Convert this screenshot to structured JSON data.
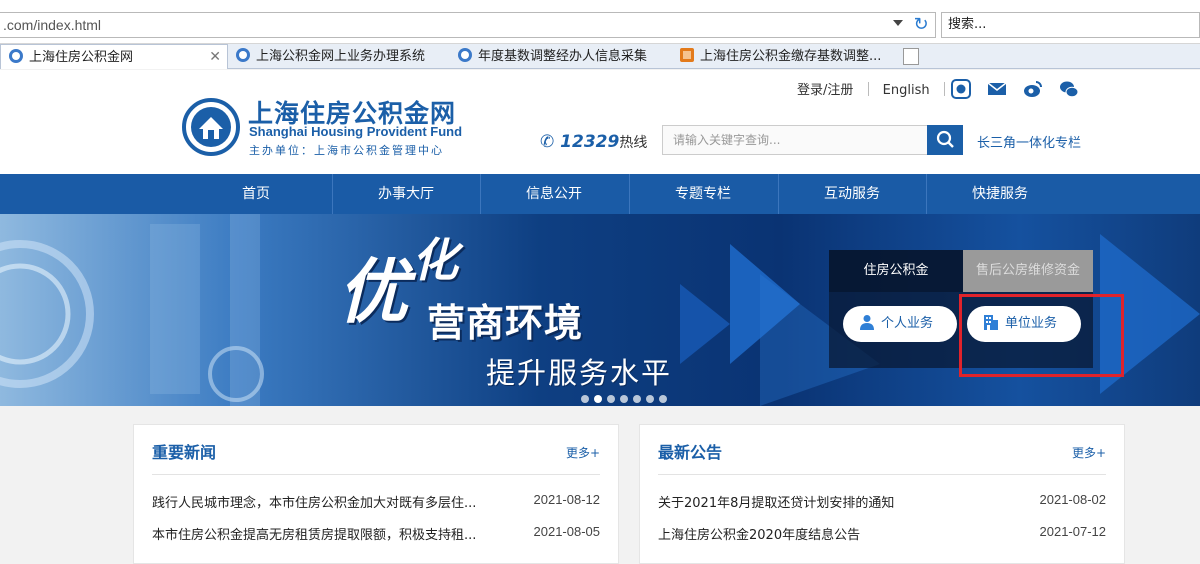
{
  "browser": {
    "address": ".com/index.html",
    "search_placeholder": "搜索...",
    "tabs": [
      {
        "label": "上海住房公积金网",
        "active": true
      },
      {
        "label": "上海公积金网上业务办理系统",
        "active": false
      },
      {
        "label": "年度基数调整经办人信息采集",
        "active": false
      },
      {
        "label": "上海住房公积金缴存基数调整...",
        "active": false
      }
    ]
  },
  "header": {
    "logo_cn": "上海住房公积金网",
    "logo_en": "Shanghai Housing Provident Fund",
    "logo_sub": "主办单位：上海市公积金管理中心",
    "login": "登录/注册",
    "english": "English",
    "hotline_number": "12329",
    "hotline_label": "热线",
    "search_placeholder": "请输入关键字查询...",
    "delta_link": "长三角一体化专栏"
  },
  "nav": {
    "items": [
      "首页",
      "办事大厅",
      "信息公开",
      "专题专栏",
      "互动服务",
      "快捷服务"
    ]
  },
  "banner": {
    "slogan_you": "优",
    "slogan_hua": "化",
    "slogan_main": "营商环境",
    "slogan_sub": "提升服务水平",
    "tab_active": "住房公积金",
    "tab_inactive": "售后公房维修资金",
    "btn_personal": "个人业务",
    "btn_company": "单位业务"
  },
  "news": {
    "title": "重要新闻",
    "more": "更多+",
    "items": [
      {
        "title": "践行人民城市理念，本市住房公积金加大对既有多层住...",
        "date": "2021-08-12"
      },
      {
        "title": "本市住房公积金提高无房租赁房提取限额，积极支持租...",
        "date": "2021-08-05"
      }
    ]
  },
  "notices": {
    "title": "最新公告",
    "more": "更多+",
    "items": [
      {
        "title": "关于2021年8月提取还贷计划安排的通知",
        "date": "2021-08-02"
      },
      {
        "title": "上海住房公积金2020年度结息公告",
        "date": "2021-07-12"
      }
    ]
  },
  "colors": {
    "brand_blue": "#1b5fa8",
    "nav_blue": "#1a5ba6",
    "highlight_red": "#e0232b"
  }
}
